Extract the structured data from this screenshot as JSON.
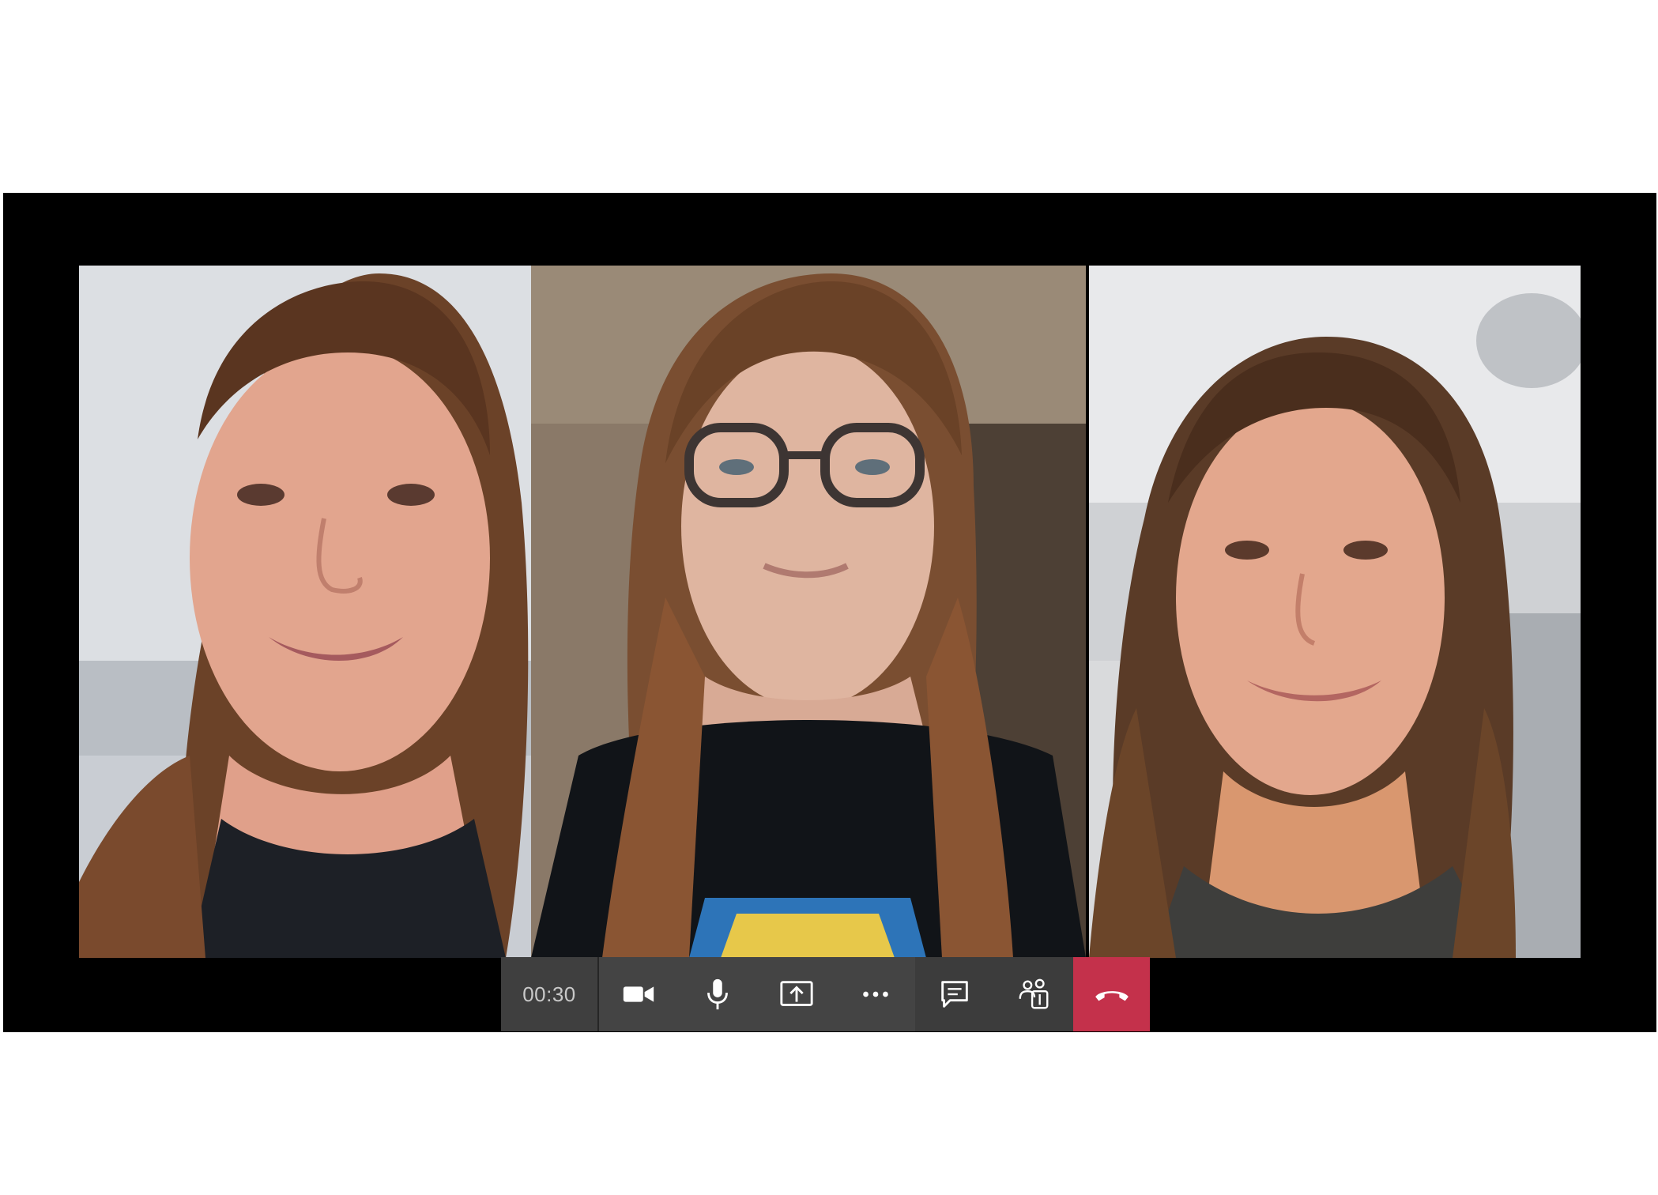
{
  "call": {
    "duration": "00:30"
  },
  "participants": [
    {
      "tile": "participant-video-1"
    },
    {
      "tile": "participant-video-2"
    },
    {
      "tile": "participant-video-3"
    }
  ],
  "controls": [
    {
      "icon": "camera-icon"
    },
    {
      "icon": "microphone-icon"
    },
    {
      "icon": "share-screen-icon"
    },
    {
      "icon": "more-options-icon"
    },
    {
      "icon": "chat-icon"
    },
    {
      "icon": "participants-icon"
    },
    {
      "icon": "hang-up-icon"
    }
  ],
  "colors": {
    "hangup": "#c4314b",
    "bar": "#444444",
    "stage": "#000000"
  }
}
